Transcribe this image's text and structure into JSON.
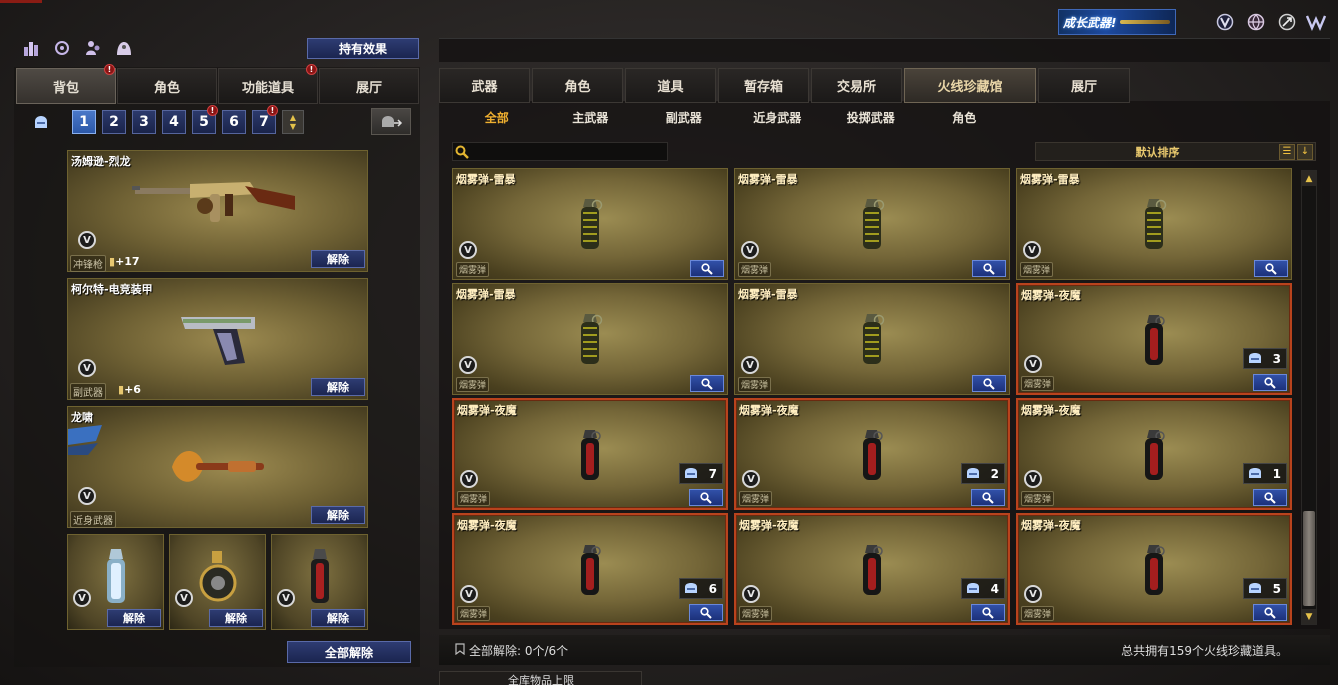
{
  "top_right": {
    "promo_text": "成长武器!",
    "icons": [
      "v-emblem-icon",
      "globe-icon",
      "achievement-icon",
      "brand-logo-icon"
    ]
  },
  "left": {
    "top_icons": [
      "ranking-icon",
      "refresh-icon",
      "friends-icon",
      "clan-icon"
    ],
    "effect_button": "持有效果",
    "tabs": [
      {
        "label": "背包",
        "alert": true
      },
      {
        "label": "角色",
        "alert": false
      },
      {
        "label": "功能道具",
        "alert": true
      },
      {
        "label": "展厅",
        "alert": false
      }
    ],
    "pages": [
      {
        "label": "1",
        "active": true,
        "alert": false
      },
      {
        "label": "2",
        "active": false,
        "alert": false
      },
      {
        "label": "3",
        "active": false,
        "alert": false
      },
      {
        "label": "4",
        "active": false,
        "alert": false
      },
      {
        "label": "5",
        "active": false,
        "alert": true
      },
      {
        "label": "6",
        "active": false,
        "alert": false
      },
      {
        "label": "7",
        "active": false,
        "alert": true
      }
    ],
    "alert_mark": "!",
    "scroll_up": "▲",
    "scroll_down": "▼",
    "equipped": [
      {
        "name": "汤姆逊-烈龙",
        "category": "冲锋枪",
        "ammo": "+17",
        "action": "解除",
        "v": "V"
      },
      {
        "name": "柯尔特-电竞装甲",
        "category": "副武器",
        "ammo": "+6",
        "action": "解除",
        "v": "V"
      },
      {
        "name": "龙啸",
        "category": "近身武器",
        "ammo": "",
        "action": "解除",
        "v": "V"
      }
    ],
    "small_slots": [
      {
        "action": "解除",
        "v": "V"
      },
      {
        "action": "解除",
        "v": "V"
      },
      {
        "action": "解除",
        "v": "V"
      }
    ],
    "remove_all": "全部解除"
  },
  "right": {
    "tabs": [
      {
        "label": "武器",
        "active": false
      },
      {
        "label": "角色",
        "active": false
      },
      {
        "label": "道具",
        "active": false
      },
      {
        "label": "暂存箱",
        "active": false
      },
      {
        "label": "交易所",
        "active": false
      },
      {
        "label": "火线珍藏馆",
        "active": true
      },
      {
        "label": "展厅",
        "active": false
      }
    ],
    "subtabs": [
      {
        "label": "全部",
        "active": true
      },
      {
        "label": "主武器",
        "active": false
      },
      {
        "label": "副武器",
        "active": false
      },
      {
        "label": "近身武器",
        "active": false
      },
      {
        "label": "投掷武器",
        "active": false
      },
      {
        "label": "角色",
        "active": false
      }
    ],
    "search": {
      "value": "",
      "placeholder": ""
    },
    "sort_label": "默认排序",
    "items": [
      {
        "name": "烟雾弹-雷暴",
        "tag": "烟雾弹",
        "count": null,
        "red": false,
        "type": "thunder"
      },
      {
        "name": "烟雾弹-雷暴",
        "tag": "烟雾弹",
        "count": null,
        "red": false,
        "type": "thunder"
      },
      {
        "name": "烟雾弹-雷暴",
        "tag": "烟雾弹",
        "count": null,
        "red": false,
        "type": "thunder"
      },
      {
        "name": "烟雾弹-雷暴",
        "tag": "烟雾弹",
        "count": null,
        "red": false,
        "type": "thunder"
      },
      {
        "name": "烟雾弹-雷暴",
        "tag": "烟雾弹",
        "count": null,
        "red": false,
        "type": "thunder"
      },
      {
        "name": "烟雾弹-夜魔",
        "tag": "烟雾弹",
        "count": "3",
        "red": true,
        "type": "night"
      },
      {
        "name": "烟雾弹-夜魔",
        "tag": "烟雾弹",
        "count": "7",
        "red": true,
        "type": "night"
      },
      {
        "name": "烟雾弹-夜魔",
        "tag": "烟雾弹",
        "count": "2",
        "red": true,
        "type": "night"
      },
      {
        "name": "烟雾弹-夜魔",
        "tag": "烟雾弹",
        "count": "1",
        "red": true,
        "type": "night"
      },
      {
        "name": "烟雾弹-夜魔",
        "tag": "烟雾弹",
        "count": "6",
        "red": true,
        "type": "night"
      },
      {
        "name": "烟雾弹-夜魔",
        "tag": "烟雾弹",
        "count": "4",
        "red": true,
        "type": "night"
      },
      {
        "name": "烟雾弹-夜魔",
        "tag": "烟雾弹",
        "count": "5",
        "red": true,
        "type": "night"
      }
    ],
    "footer_left": "全部解除: 0个/6个",
    "footer_right": "总共拥有159个火线珍藏道具。",
    "bottom_tab": "全库物品上限"
  },
  "colors": {
    "accent_gold": "#f0b030",
    "button_blue": "#2c3a6c",
    "rare_border": "#b9431d"
  }
}
